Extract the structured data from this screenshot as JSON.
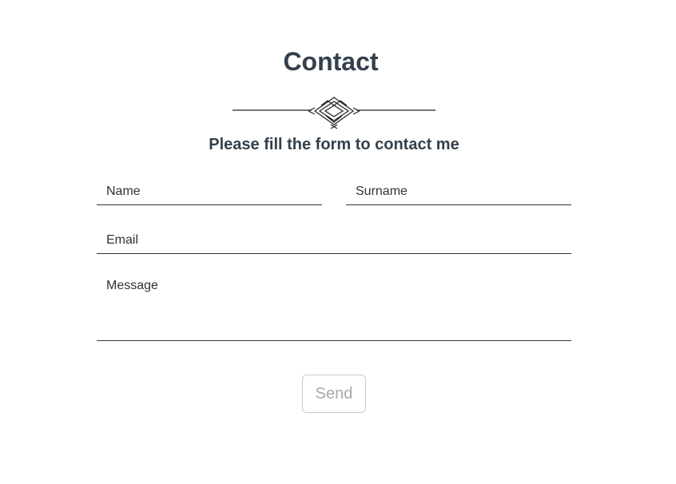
{
  "contact": {
    "title": "Contact",
    "subtitle": "Please fill the form to contact me",
    "ornament_icon": "decorative-divider-icon",
    "fields": {
      "name": {
        "placeholder": "Name",
        "value": ""
      },
      "surname": {
        "placeholder": "Surname",
        "value": ""
      },
      "email": {
        "placeholder": "Email",
        "value": ""
      },
      "message": {
        "placeholder": "Message",
        "value": ""
      }
    },
    "send_label": "Send"
  },
  "colors": {
    "heading": "#34404c",
    "field_text": "#333333",
    "field_border": "#333333",
    "button_text_disabled": "#a8a8a8",
    "button_border": "#c8c8c8",
    "background": "#ffffff"
  }
}
